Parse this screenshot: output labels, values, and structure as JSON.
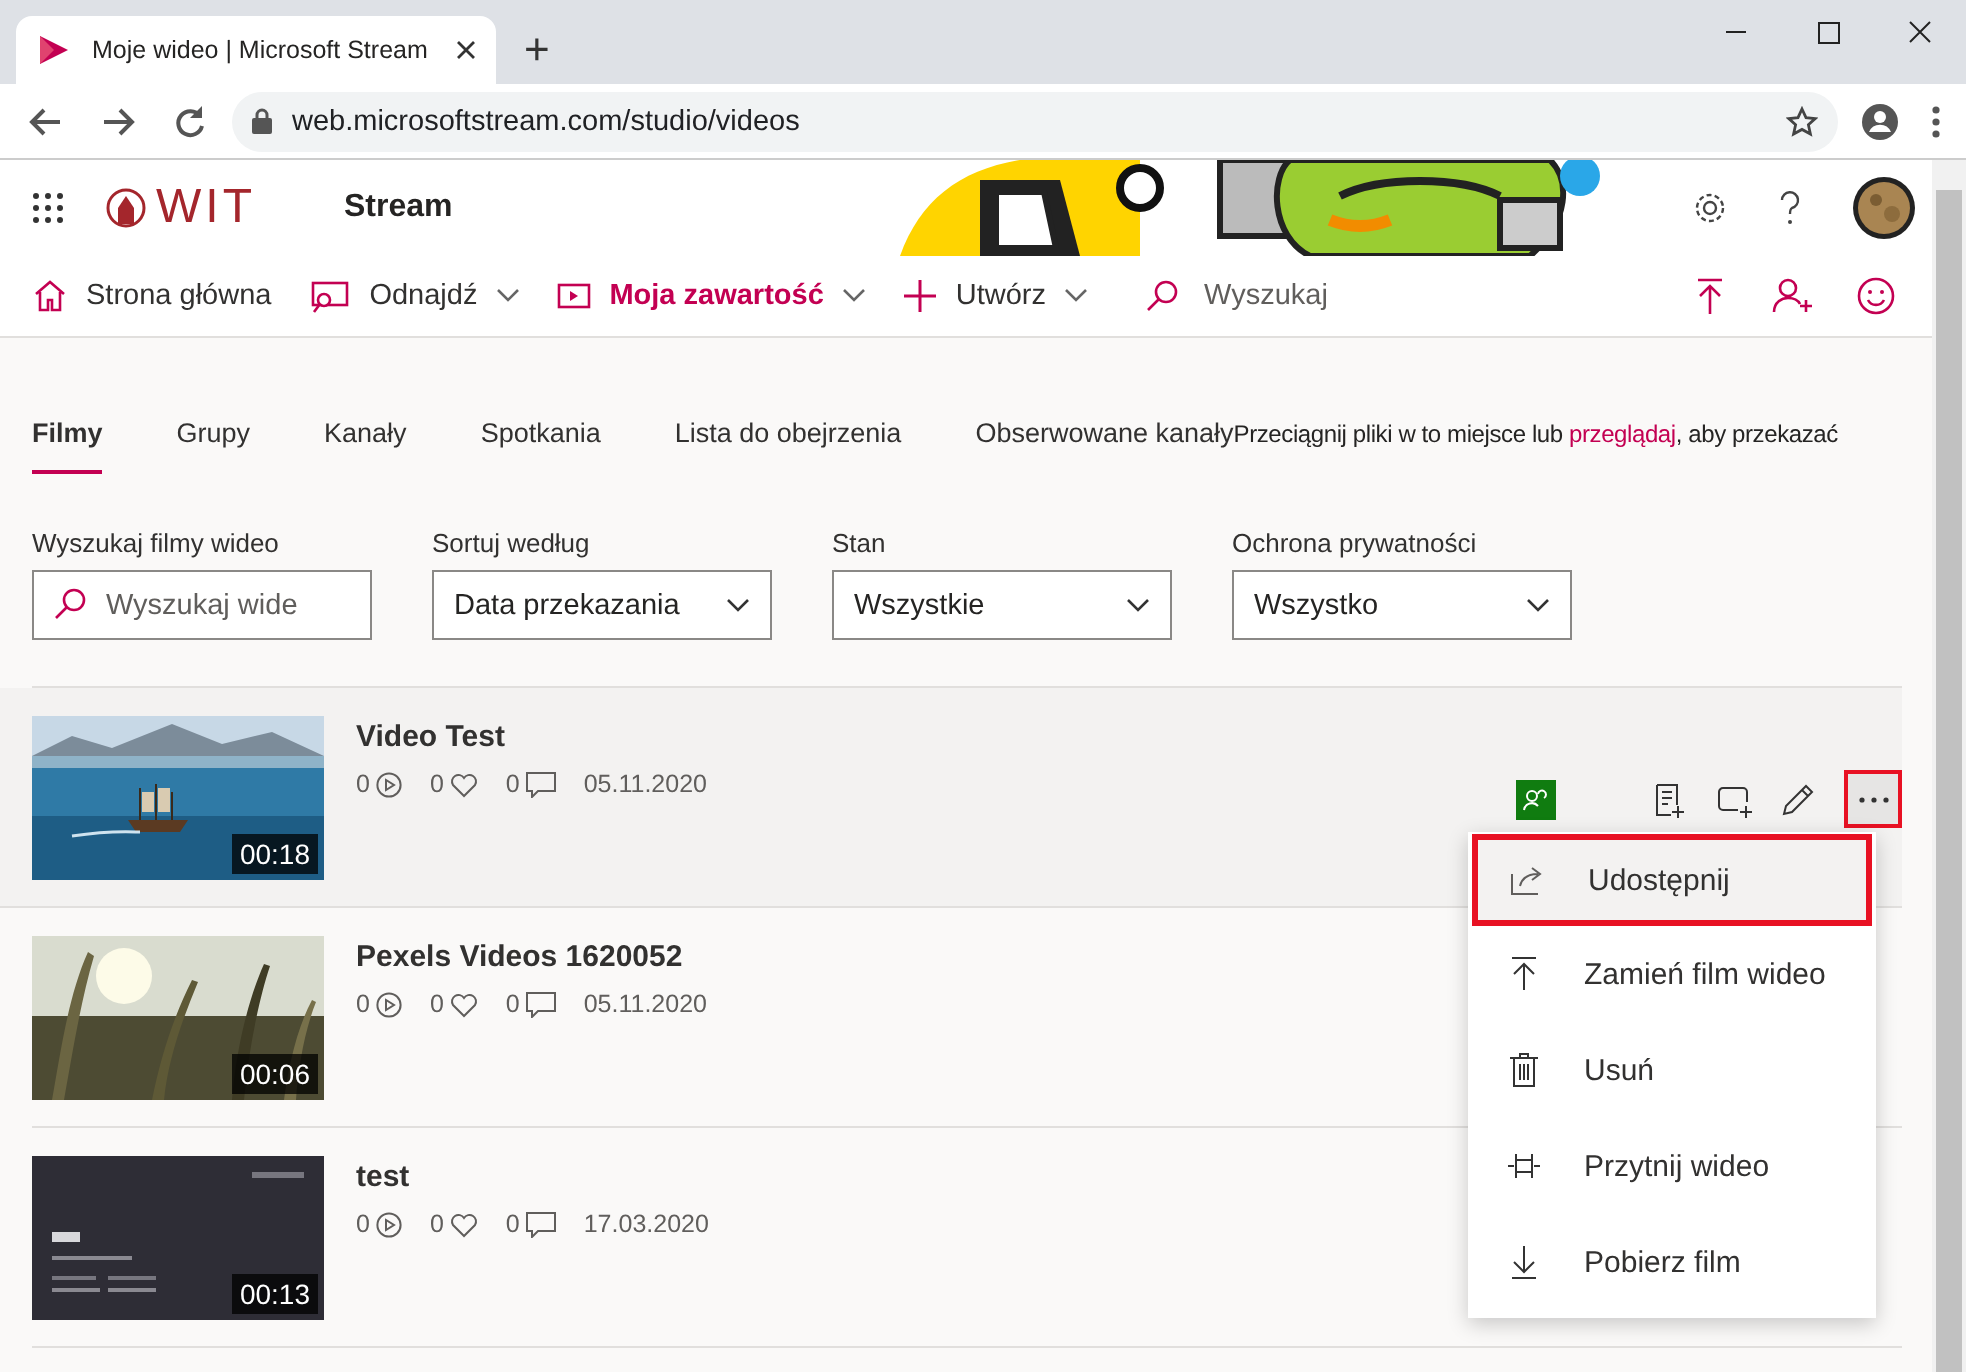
{
  "browser": {
    "tab_title": "Moje wideo | Microsoft Stream",
    "new_tab": "+",
    "url": "web.microsoftstream.com/studio/videos"
  },
  "header": {
    "logo": "WIT",
    "app": "Stream"
  },
  "nav": [
    {
      "label": "Strona główna",
      "selected": false,
      "dropdown": false
    },
    {
      "label": "Odnajdź",
      "selected": false,
      "dropdown": true
    },
    {
      "label": "Moja zawartość",
      "selected": true,
      "dropdown": true
    },
    {
      "label": "Utwórz",
      "selected": false,
      "dropdown": true
    }
  ],
  "search": {
    "placeholder": "Wyszukaj"
  },
  "tabs": [
    {
      "label": "Filmy",
      "selected": true
    },
    {
      "label": "Grupy",
      "selected": false
    },
    {
      "label": "Kanały",
      "selected": false
    },
    {
      "label": "Spotkania",
      "selected": false
    },
    {
      "label": "Lista do obejrzenia",
      "selected": false
    },
    {
      "label": "Obserwowane kanały",
      "selected": false
    }
  ],
  "drop_hint": {
    "before": "Przeciągnij pliki w to miejsce lub ",
    "link": "przeglądaj",
    "after": ", aby przekazać"
  },
  "filters": [
    {
      "label": "Wyszukaj filmy wideo",
      "kind": "search",
      "placeholder": "Wyszukaj wide"
    },
    {
      "label": "Sortuj według",
      "kind": "dropdown",
      "value": "Data przekazania"
    },
    {
      "label": "Stan",
      "kind": "dropdown",
      "value": "Wszystkie"
    },
    {
      "label": "Ochrona prywatności",
      "kind": "dropdown",
      "value": "Wszystko"
    }
  ],
  "videos": [
    {
      "title": "Video Test",
      "duration": "00:18",
      "views": "0",
      "likes": "0",
      "comments": "0",
      "date": "05.11.2020",
      "selected": true
    },
    {
      "title": "Pexels Videos 1620052",
      "duration": "00:06",
      "views": "0",
      "likes": "0",
      "comments": "0",
      "date": "05.11.2020",
      "selected": false
    },
    {
      "title": "test",
      "duration": "00:13",
      "views": "0",
      "likes": "0",
      "comments": "0",
      "date": "17.03.2020",
      "selected": false
    }
  ],
  "more_button": {
    "highlighted": true
  },
  "menu": [
    {
      "label": "Udostępnij",
      "highlighted": true
    },
    {
      "label": "Zamień film wideo",
      "highlighted": false
    },
    {
      "label": "Usuń",
      "highlighted": false
    },
    {
      "label": "Przytnij wideo",
      "highlighted": false
    },
    {
      "label": "Pobierz film",
      "highlighted": false
    }
  ]
}
